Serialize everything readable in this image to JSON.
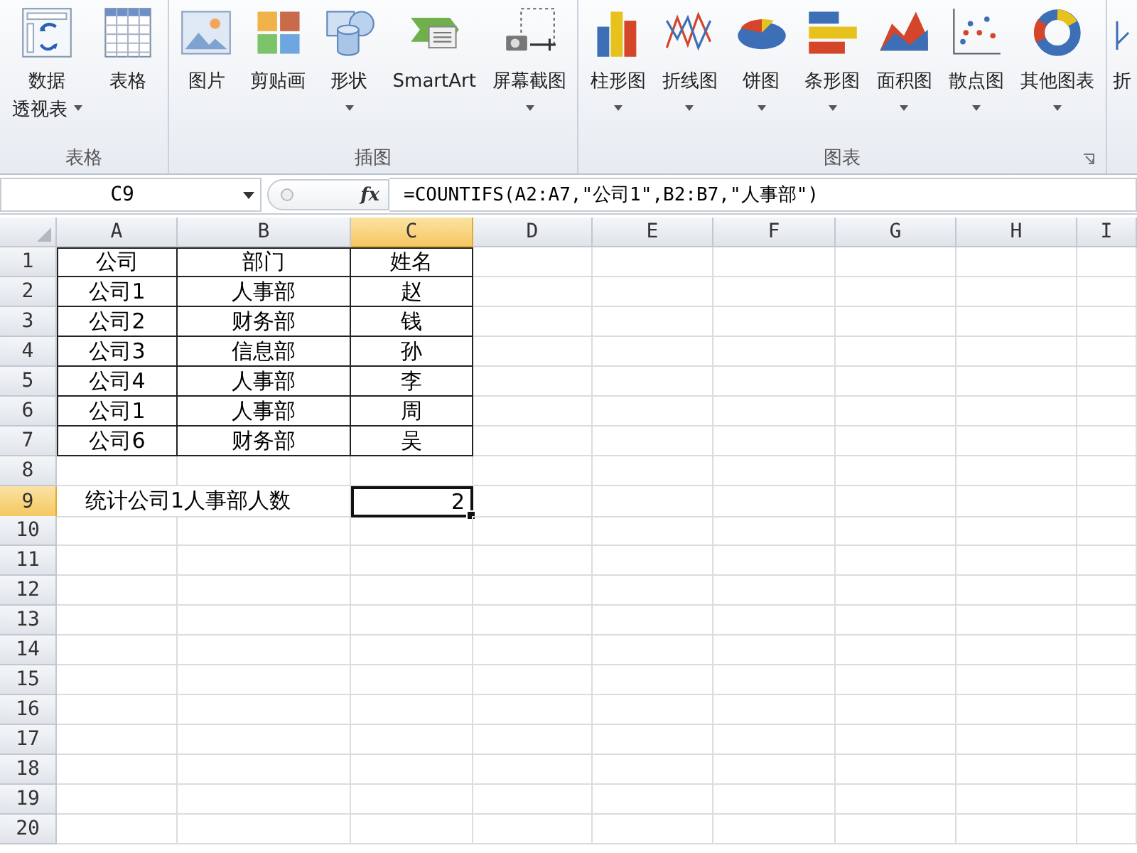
{
  "ribbon": {
    "groups": [
      {
        "label": "表格",
        "items": [
          {
            "kind": "pivot",
            "lines": [
              "数据",
              "透视表"
            ],
            "has_dropdown": true,
            "arrow_below": false
          },
          {
            "kind": "table",
            "lines": [
              "表格"
            ],
            "has_dropdown": false
          }
        ]
      },
      {
        "label": "插图",
        "items": [
          {
            "kind": "picture",
            "lines": [
              "图片"
            ],
            "has_dropdown": false
          },
          {
            "kind": "clipart",
            "lines": [
              "剪贴画"
            ],
            "has_dropdown": false
          },
          {
            "kind": "shapes",
            "lines": [
              "形状"
            ],
            "has_dropdown": true,
            "arrow_below": true
          },
          {
            "kind": "smartart",
            "lines": [
              "SmartArt"
            ],
            "has_dropdown": false
          },
          {
            "kind": "screenshot",
            "lines": [
              "屏幕截图"
            ],
            "has_dropdown": true,
            "arrow_below": true
          }
        ]
      },
      {
        "label": "图表",
        "launcher": true,
        "items": [
          {
            "kind": "column",
            "lines": [
              "柱形图"
            ],
            "has_dropdown": true,
            "arrow_below": true
          },
          {
            "kind": "line",
            "lines": [
              "折线图"
            ],
            "has_dropdown": true,
            "arrow_below": true
          },
          {
            "kind": "pie",
            "lines": [
              "饼图"
            ],
            "has_dropdown": true,
            "arrow_below": true
          },
          {
            "kind": "bar",
            "lines": [
              "条形图"
            ],
            "has_dropdown": true,
            "arrow_below": true
          },
          {
            "kind": "area",
            "lines": [
              "面积图"
            ],
            "has_dropdown": true,
            "arrow_below": true
          },
          {
            "kind": "scatter",
            "lines": [
              "散点图"
            ],
            "has_dropdown": true,
            "arrow_below": true
          },
          {
            "kind": "other",
            "lines": [
              "其他图表"
            ],
            "has_dropdown": true,
            "arrow_below": true
          }
        ]
      },
      {
        "items": [
          {
            "kind": "sparkline",
            "lines": [
              "折"
            ],
            "has_dropdown": false
          }
        ]
      }
    ]
  },
  "formula_bar": {
    "name_box": "C9",
    "function_label": "fx",
    "formula": "=COUNTIFS(A2:A7,\"公司1\",B2:B7,\"人事部\")"
  },
  "sheet": {
    "columns": [
      {
        "label": "A",
        "selected": false
      },
      {
        "label": "B",
        "selected": false
      },
      {
        "label": "C",
        "selected": true
      },
      {
        "label": "D",
        "selected": false
      },
      {
        "label": "E",
        "selected": false
      },
      {
        "label": "F",
        "selected": false
      },
      {
        "label": "G",
        "selected": false
      },
      {
        "label": "H",
        "selected": false
      },
      {
        "label": "I",
        "selected": false
      }
    ],
    "rows": [
      {
        "number": "1",
        "selected": false,
        "kind": "table",
        "cells": [
          "公司",
          "部门",
          "姓名"
        ]
      },
      {
        "number": "2",
        "selected": false,
        "kind": "table",
        "cells": [
          "公司1",
          "人事部",
          "赵"
        ]
      },
      {
        "number": "3",
        "selected": false,
        "kind": "table",
        "cells": [
          "公司2",
          "财务部",
          "钱"
        ]
      },
      {
        "number": "4",
        "selected": false,
        "kind": "table",
        "cells": [
          "公司3",
          "信息部",
          "孙"
        ]
      },
      {
        "number": "5",
        "selected": false,
        "kind": "table",
        "cells": [
          "公司4",
          "人事部",
          "李"
        ]
      },
      {
        "number": "6",
        "selected": false,
        "kind": "table",
        "cells": [
          "公司1",
          "人事部",
          "周"
        ]
      },
      {
        "number": "7",
        "selected": false,
        "kind": "table",
        "cells": [
          "公司6",
          "财务部",
          "吴"
        ]
      },
      {
        "number": "8",
        "selected": false,
        "kind": "blank"
      },
      {
        "number": "9",
        "selected": true,
        "kind": "summary",
        "label": "统计公司1人事部人数",
        "value": "2",
        "value_selected": true
      },
      {
        "number": "10",
        "selected": false,
        "kind": "blank"
      },
      {
        "number": "11",
        "selected": false,
        "kind": "blank"
      },
      {
        "number": "12",
        "selected": false,
        "kind": "blank"
      },
      {
        "number": "13",
        "selected": false,
        "kind": "blank"
      },
      {
        "number": "14",
        "selected": false,
        "kind": "blank"
      },
      {
        "number": "15",
        "selected": false,
        "kind": "blank"
      },
      {
        "number": "16",
        "selected": false,
        "kind": "blank"
      },
      {
        "number": "17",
        "selected": false,
        "kind": "blank"
      },
      {
        "number": "18",
        "selected": false,
        "kind": "blank"
      },
      {
        "number": "19",
        "selected": false,
        "kind": "blank"
      },
      {
        "number": "20",
        "selected": false,
        "kind": "blank"
      }
    ]
  }
}
